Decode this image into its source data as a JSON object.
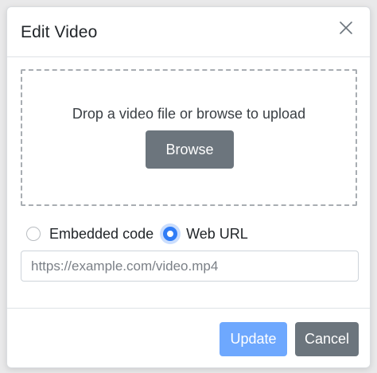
{
  "dialog": {
    "title": "Edit Video",
    "close_icon": "close-icon"
  },
  "dropzone": {
    "text": "Drop a video file or browse to upload",
    "browse_label": "Browse"
  },
  "source_options": [
    {
      "label": "Embedded code",
      "checked": false
    },
    {
      "label": "Web URL",
      "checked": true
    }
  ],
  "url_input": {
    "value": "",
    "placeholder": "https://example.com/video.mp4"
  },
  "footer": {
    "update_label": "Update",
    "cancel_label": "Cancel"
  },
  "colors": {
    "primary_disabled": "#6ea8fe",
    "secondary": "#6c757d",
    "radio_checked": "#2f7cf6"
  }
}
